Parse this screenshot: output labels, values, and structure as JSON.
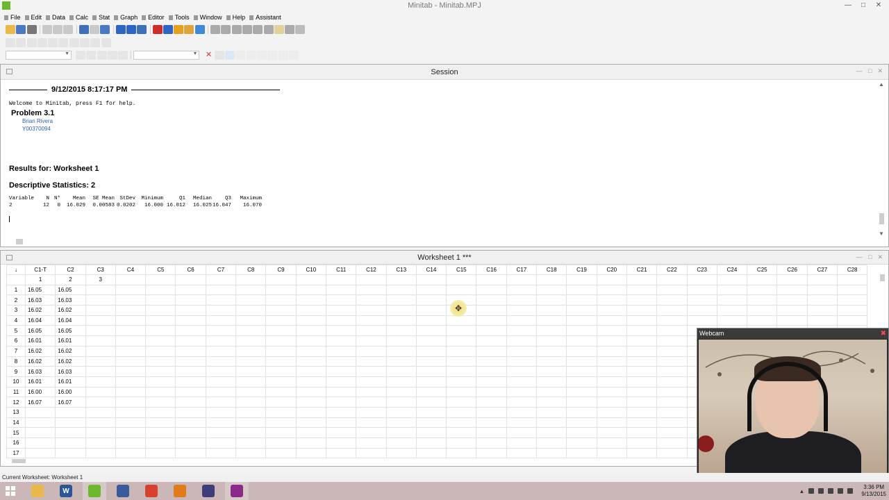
{
  "app": {
    "title": "Minitab - Minitab.MPJ"
  },
  "menu": [
    {
      "label": "File",
      "id": "file"
    },
    {
      "label": "Edit",
      "id": "edit"
    },
    {
      "label": "Data",
      "id": "data"
    },
    {
      "label": "Calc",
      "id": "calc"
    },
    {
      "label": "Stat",
      "id": "stat"
    },
    {
      "label": "Graph",
      "id": "graph"
    },
    {
      "label": "Editor",
      "id": "editor"
    },
    {
      "label": "Tools",
      "id": "tools"
    },
    {
      "label": "Window",
      "id": "window"
    },
    {
      "label": "Help",
      "id": "help"
    },
    {
      "label": "Assistant",
      "id": "assistant"
    }
  ],
  "session": {
    "title": "Session",
    "date": "9/12/2015 8:17:17 PM",
    "welcome": "Welcome to Minitab, press F1 for help.",
    "problem": "Problem 3.1",
    "name": "Brian Rivera",
    "id": "Y00370094",
    "results": "Results for: Worksheet 1",
    "descriptive": "Descriptive Statistics: 2",
    "stats_header": [
      "Variable",
      "N",
      "N*",
      "Mean",
      "SE Mean",
      "StDev",
      "Minimum",
      "Q1",
      "Median",
      "Q3",
      "Maximum"
    ],
    "stats_row": [
      "2",
      "12",
      "0",
      "16.029",
      "0.00583",
      "0.0202",
      "16.000",
      "16.012",
      "16.025",
      "16.047",
      "16.070"
    ]
  },
  "worksheet": {
    "title": "Worksheet 1 ***",
    "columns": [
      "C1-T",
      "C2",
      "C3",
      "C4",
      "C5",
      "C6",
      "C7",
      "C8",
      "C9",
      "C10",
      "C11",
      "C12",
      "C13",
      "C14",
      "C15",
      "C16",
      "C17",
      "C18",
      "C19",
      "C20",
      "C21",
      "C22",
      "C23",
      "C24",
      "C25",
      "C26",
      "C27",
      "C28"
    ],
    "names": [
      "1",
      "2",
      "3"
    ],
    "rows": [
      "1",
      "2",
      "3",
      "4",
      "5",
      "6",
      "7",
      "8",
      "9",
      "10",
      "11",
      "12",
      "13",
      "14",
      "15",
      "16",
      "17"
    ],
    "c1": [
      "16.05",
      "16.03",
      "16.02",
      "16.04",
      "16.05",
      "16.01",
      "16.02",
      "16.02",
      "16.03",
      "16.01",
      "16.00",
      "16.07"
    ],
    "c2": [
      "16.05",
      "16.03",
      "16.02",
      "16.04",
      "16.05",
      "16.01",
      "16.02",
      "16.02",
      "16.03",
      "16.01",
      "16.00",
      "16.07"
    ]
  },
  "webcam": {
    "title": "Webcam"
  },
  "status": {
    "text": "Current Worksheet: Worksheet 1"
  },
  "clock": {
    "time": "3:36 PM",
    "date": "9/13/2015"
  },
  "colors": {
    "taskbar": "#cbb7b7",
    "accent_link": "#2a5fb0",
    "minitab_green": "#6bb82c"
  },
  "taskbar_apps": [
    {
      "name": "file-explorer-icon",
      "color": "#e8b84a",
      "glyph": ""
    },
    {
      "name": "word-icon",
      "color": "#2b5797",
      "glyph": "W"
    },
    {
      "name": "minitab-icon",
      "color": "#6bb82c",
      "glyph": ""
    },
    {
      "name": "calculator-icon",
      "color": "#3a5a9a",
      "glyph": ""
    },
    {
      "name": "chrome-icon",
      "color": "#d9412f",
      "glyph": ""
    },
    {
      "name": "media-app-icon",
      "color": "#e07b1a",
      "glyph": ""
    },
    {
      "name": "video-app-icon",
      "color": "#3d3d7a",
      "glyph": ""
    },
    {
      "name": "screen-recorder-icon",
      "color": "#8c2a8c",
      "glyph": ""
    }
  ]
}
